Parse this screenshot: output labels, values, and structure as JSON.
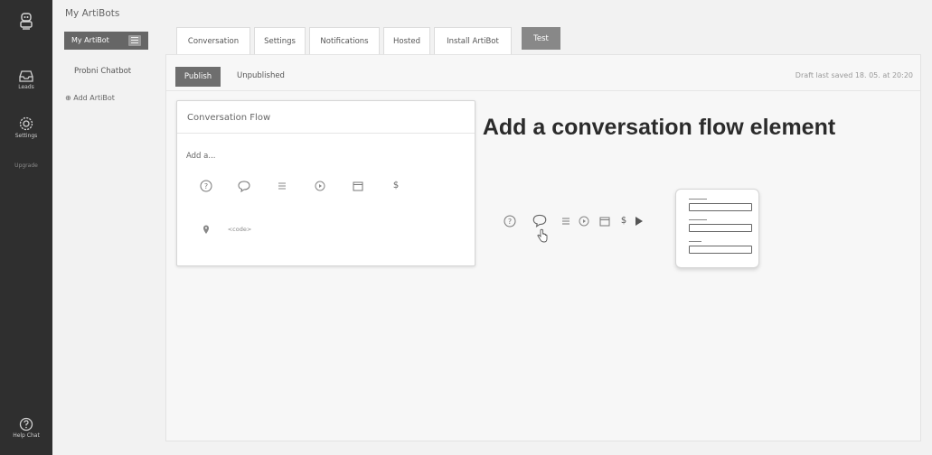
{
  "rail": {
    "logo_icon": "robot-icon",
    "leads_label": "Leads",
    "settings_label": "Settings",
    "upgrade_label": "Upgrade",
    "help_label": "Help Chat"
  },
  "bots": {
    "title": "My ArtiBots",
    "active_label": "My ArtiBot",
    "items": [
      "Probni Chatbot"
    ],
    "add_label": "⊕ Add ArtiBot"
  },
  "tabs": [
    {
      "label": "Conversation",
      "active": true
    },
    {
      "label": "Settings"
    },
    {
      "label": "Notifications"
    },
    {
      "label": "Hosted"
    },
    {
      "label": "Install ArtiBot"
    },
    {
      "label": "Test"
    }
  ],
  "subbar": {
    "publish_label": "Publish",
    "unpublished_label": "Unpublished",
    "draft_status": "Draft last saved 18. 05. at 20:20"
  },
  "flow": {
    "title": "Conversation Flow",
    "add_label": "Add a...",
    "elements": [
      "question-icon",
      "chat-bubble-icon",
      "list-icon",
      "play-icon",
      "calendar-icon",
      "dollar-icon",
      "location-pin-icon",
      "code-icon"
    ],
    "code_label": "<code>",
    "dollar_label": "$"
  },
  "hero": {
    "title": "Add a conversation flow element",
    "strip_icons": [
      "question-icon",
      "chat-bubble-icon",
      "cursor-hand-icon",
      "list-icon",
      "play-icon",
      "calendar-icon",
      "dollar-icon",
      "arrow-right-icon"
    ],
    "dollar_label": "$"
  },
  "colors": {
    "rail_bg": "#2f2f2f",
    "accent_gray": "#6e6e6e"
  }
}
